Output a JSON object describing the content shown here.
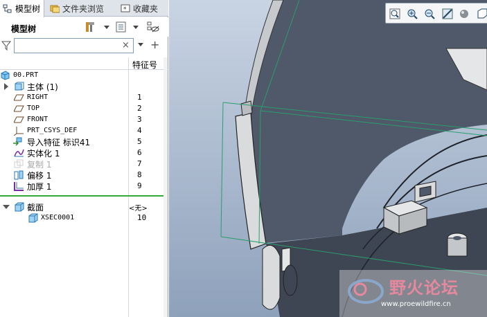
{
  "tabs": [
    {
      "label": "模型树",
      "icon": "model-tree-icon",
      "active": true
    },
    {
      "label": "文件夹浏览",
      "icon": "folder-browser-icon",
      "active": false
    },
    {
      "label": "收藏夹",
      "icon": "favorites-icon",
      "active": false
    }
  ],
  "toolbar": {
    "title": "模型树",
    "icons": [
      "tools-icon",
      "settings-list-icon",
      "show-hide-icon"
    ]
  },
  "filter": {
    "value": "",
    "clear_glyph": "×",
    "add_glyph": "+"
  },
  "columns": {
    "feature_no": "特征号"
  },
  "tree": {
    "root": {
      "label": "00.PRT"
    },
    "items": [
      {
        "label": "主体 (1)",
        "num": ""
      },
      {
        "label": "RIGHT",
        "num": "1"
      },
      {
        "label": "TOP",
        "num": "2"
      },
      {
        "label": "FRONT",
        "num": "3"
      },
      {
        "label": "PRT_CSYS_DEF",
        "num": "4"
      },
      {
        "label": "导入特征 标识41",
        "num": "5"
      },
      {
        "label": "实体化 1",
        "num": "6"
      },
      {
        "label": "复制 1",
        "num": "7"
      },
      {
        "label": "偏移 1",
        "num": "8"
      },
      {
        "label": "加厚 1",
        "num": "9"
      }
    ],
    "sections": {
      "label": "截面",
      "num": "<无>",
      "children": [
        {
          "label": "XSEC0001",
          "num": "10"
        }
      ]
    }
  },
  "view_toolbar": {
    "icons": [
      "zoom-fit-icon",
      "zoom-in-icon",
      "zoom-out-icon",
      "repaint-icon",
      "display-style-icon",
      "view-box-icon"
    ]
  },
  "watermark": {
    "title": "野火论坛",
    "url": "www.proewildfire.cn"
  },
  "colors": {
    "accent_green": "#33aa33",
    "selection_box": "#2a9d6e",
    "part_dark": "#4a5260",
    "part_light": "#d8dadc"
  }
}
